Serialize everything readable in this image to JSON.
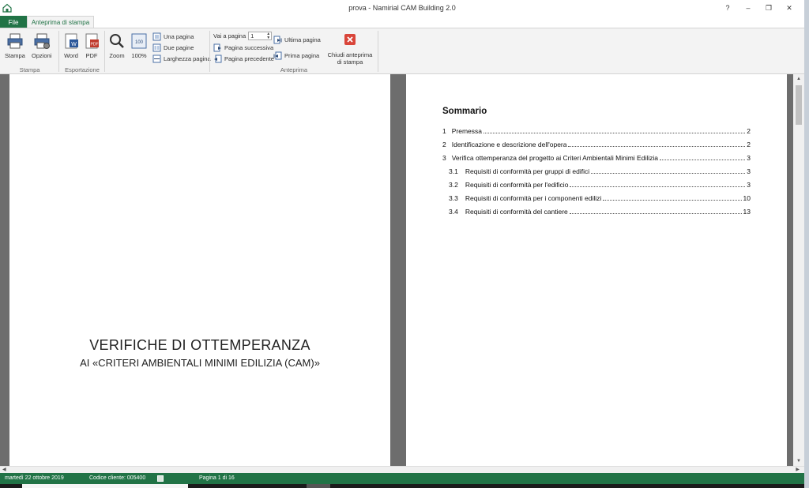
{
  "window": {
    "title": "prova - Namirial CAM Building 2.0",
    "help": "?",
    "minimize": "–",
    "restore": "❐",
    "close": "✕"
  },
  "tabs": {
    "file": "File",
    "active": "Anteprima di stampa"
  },
  "ribbon": {
    "stampa": "Stampa",
    "opzioni": "Opzioni",
    "group_stampa": "Stampa",
    "word": "Word",
    "pdf": "PDF",
    "group_esportazione": "Esportazione",
    "zoom": "Zoom",
    "zoom100": "100%",
    "una_pagina": "Una pagina",
    "due_pagine": "Due pagine",
    "larghezza_pagina": "Larghezza pagina",
    "vai_a_pagina": "Vai a pagina",
    "page_value": "1",
    "pagina_successiva": "Pagina successiva",
    "pagina_precedente": "Pagina precedente",
    "ultima_pagina": "Ultima pagina",
    "prima_pagina": "Prima pagina",
    "group_anteprima": "Anteprima",
    "chiudi_line1": "Chiudi anteprima",
    "chiudi_line2": "di stampa"
  },
  "cover": {
    "title": "VERIFICHE DI OTTEMPERANZA",
    "subtitle": "AI «CRITERI AMBIENTALI MINIMI EDILIZIA (CAM)»"
  },
  "toc": {
    "title": "Sommario",
    "entries": [
      {
        "num": "1",
        "text": "Premessa",
        "page": "2"
      },
      {
        "num": "2",
        "text": "Identificazione e descrizione dell'opera",
        "page": "2"
      },
      {
        "num": "3",
        "text": "Verifica ottemperanza del progetto ai Criteri Ambientali Minimi Edilizia",
        "page": "3"
      },
      {
        "num": "3.1",
        "text": "Requisiti di conformità per gruppi di edifici",
        "page": "3"
      },
      {
        "num": "3.2",
        "text": "Requisiti di conformità per l'edificio",
        "page": "3"
      },
      {
        "num": "3.3",
        "text": "Requisiti di conformità per i componenti edilizi",
        "page": "10"
      },
      {
        "num": "3.4",
        "text": "Requisiti di conformità del cantiere",
        "page": "13"
      }
    ]
  },
  "status": {
    "date": "martedì 22 ottobre 2019",
    "client_code": "Codice cliente: 005400",
    "page": "Pagina 1 di 16"
  },
  "colors": {
    "accent": "#217346",
    "workarea": "#6d6d6d",
    "close_button": "#d9453a"
  }
}
